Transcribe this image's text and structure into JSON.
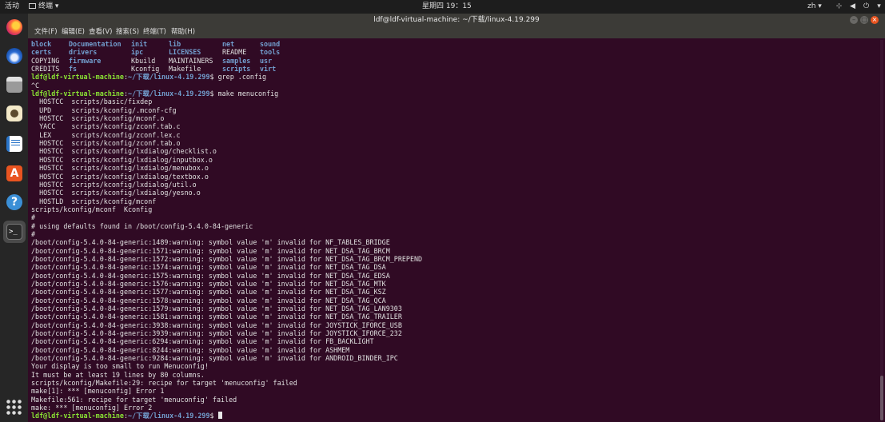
{
  "topbar": {
    "activities": "活动",
    "app_menu": "终端",
    "clock": "星期四 19：15",
    "lang": "zh",
    "icons": [
      "network-icon",
      "volume-icon",
      "power-icon",
      "chevron-down-icon"
    ]
  },
  "dock": {
    "items": [
      {
        "name": "firefox",
        "icon": "firefox-icon"
      },
      {
        "name": "thunderbird",
        "icon": "mail-icon"
      },
      {
        "name": "files",
        "icon": "folder-icon"
      },
      {
        "name": "rhythmbox",
        "icon": "music-icon"
      },
      {
        "name": "writer",
        "icon": "document-icon"
      },
      {
        "name": "software",
        "icon": "software-center-icon",
        "glyph": "A"
      },
      {
        "name": "help",
        "icon": "help-icon",
        "glyph": "?"
      },
      {
        "name": "terminal",
        "icon": "terminal-icon",
        "glyph": ">_",
        "active": true
      }
    ]
  },
  "window": {
    "title": "ldf@ldf-virtual-machine: ~/下载/linux-4.19.299",
    "menu": {
      "file": "文件(F)",
      "edit": "编辑(E)",
      "view": "查看(V)",
      "search": "搜索(S)",
      "terminal": "终端(T)",
      "help": "帮助(H)"
    }
  },
  "terminal": {
    "ls_columns": [
      [
        {
          "t": "block",
          "c": "b"
        },
        {
          "t": "certs",
          "c": "b"
        },
        {
          "t": "COPYING",
          "c": ""
        },
        {
          "t": "CREDITS",
          "c": ""
        }
      ],
      [
        {
          "t": "Documentation",
          "c": "b"
        },
        {
          "t": "drivers",
          "c": "b"
        },
        {
          "t": "firmware",
          "c": "b"
        },
        {
          "t": "fs",
          "c": "b"
        }
      ],
      [
        {
          "t": "init",
          "c": "b"
        },
        {
          "t": "ipc",
          "c": "b"
        },
        {
          "t": "Kbuild",
          "c": ""
        },
        {
          "t": "Kconfig",
          "c": ""
        }
      ],
      [
        {
          "t": "lib",
          "c": "b"
        },
        {
          "t": "LICENSES",
          "c": "b"
        },
        {
          "t": "MAINTAINERS",
          "c": ""
        },
        {
          "t": "Makefile",
          "c": ""
        }
      ],
      [
        {
          "t": "net",
          "c": "b"
        },
        {
          "t": "README",
          "c": ""
        },
        {
          "t": "samples",
          "c": "b"
        },
        {
          "t": "scripts",
          "c": "b"
        }
      ],
      [
        {
          "t": "sound",
          "c": "b"
        },
        {
          "t": "tools",
          "c": "b"
        },
        {
          "t": "usr",
          "c": "b"
        },
        {
          "t": "virt",
          "c": "b"
        }
      ]
    ],
    "prompt_user": "ldf@ldf-virtual-machine",
    "prompt_path": "~/下载/linux-4.19.299",
    "lines": [
      {
        "type": "prompt",
        "cmd": "grep .config"
      },
      {
        "type": "out",
        "text": "^C"
      },
      {
        "type": "prompt",
        "cmd": "make menuconfig"
      },
      {
        "type": "out",
        "text": "  HOSTCC  scripts/basic/fixdep"
      },
      {
        "type": "out",
        "text": "  UPD     scripts/kconfig/.mconf-cfg"
      },
      {
        "type": "out",
        "text": "  HOSTCC  scripts/kconfig/mconf.o"
      },
      {
        "type": "out",
        "text": "  YACC    scripts/kconfig/zconf.tab.c"
      },
      {
        "type": "out",
        "text": "  LEX     scripts/kconfig/zconf.lex.c"
      },
      {
        "type": "out",
        "text": "  HOSTCC  scripts/kconfig/zconf.tab.o"
      },
      {
        "type": "out",
        "text": "  HOSTCC  scripts/kconfig/lxdialog/checklist.o"
      },
      {
        "type": "out",
        "text": "  HOSTCC  scripts/kconfig/lxdialog/inputbox.o"
      },
      {
        "type": "out",
        "text": "  HOSTCC  scripts/kconfig/lxdialog/menubox.o"
      },
      {
        "type": "out",
        "text": "  HOSTCC  scripts/kconfig/lxdialog/textbox.o"
      },
      {
        "type": "out",
        "text": "  HOSTCC  scripts/kconfig/lxdialog/util.o"
      },
      {
        "type": "out",
        "text": "  HOSTCC  scripts/kconfig/lxdialog/yesno.o"
      },
      {
        "type": "out",
        "text": "  HOSTLD  scripts/kconfig/mconf"
      },
      {
        "type": "out",
        "text": "scripts/kconfig/mconf  Kconfig"
      },
      {
        "type": "out",
        "text": "#"
      },
      {
        "type": "out",
        "text": "# using defaults found in /boot/config-5.4.0-84-generic"
      },
      {
        "type": "out",
        "text": "#"
      },
      {
        "type": "out",
        "text": "/boot/config-5.4.0-84-generic:1489:warning: symbol value 'm' invalid for NF_TABLES_BRIDGE"
      },
      {
        "type": "out",
        "text": "/boot/config-5.4.0-84-generic:1571:warning: symbol value 'm' invalid for NET_DSA_TAG_BRCM"
      },
      {
        "type": "out",
        "text": "/boot/config-5.4.0-84-generic:1572:warning: symbol value 'm' invalid for NET_DSA_TAG_BRCM_PREPEND"
      },
      {
        "type": "out",
        "text": "/boot/config-5.4.0-84-generic:1574:warning: symbol value 'm' invalid for NET_DSA_TAG_DSA"
      },
      {
        "type": "out",
        "text": "/boot/config-5.4.0-84-generic:1575:warning: symbol value 'm' invalid for NET_DSA_TAG_EDSA"
      },
      {
        "type": "out",
        "text": "/boot/config-5.4.0-84-generic:1576:warning: symbol value 'm' invalid for NET_DSA_TAG_MTK"
      },
      {
        "type": "out",
        "text": "/boot/config-5.4.0-84-generic:1577:warning: symbol value 'm' invalid for NET_DSA_TAG_KSZ"
      },
      {
        "type": "out",
        "text": "/boot/config-5.4.0-84-generic:1578:warning: symbol value 'm' invalid for NET_DSA_TAG_QCA"
      },
      {
        "type": "out",
        "text": "/boot/config-5.4.0-84-generic:1579:warning: symbol value 'm' invalid for NET_DSA_TAG_LAN9303"
      },
      {
        "type": "out",
        "text": "/boot/config-5.4.0-84-generic:1581:warning: symbol value 'm' invalid for NET_DSA_TAG_TRAILER"
      },
      {
        "type": "out",
        "text": "/boot/config-5.4.0-84-generic:3938:warning: symbol value 'm' invalid for JOYSTICK_IFORCE_USB"
      },
      {
        "type": "out",
        "text": "/boot/config-5.4.0-84-generic:3939:warning: symbol value 'm' invalid for JOYSTICK_IFORCE_232"
      },
      {
        "type": "out",
        "text": "/boot/config-5.4.0-84-generic:6294:warning: symbol value 'm' invalid for FB_BACKLIGHT"
      },
      {
        "type": "out",
        "text": "/boot/config-5.4.0-84-generic:8244:warning: symbol value 'm' invalid for ASHMEM"
      },
      {
        "type": "out",
        "text": "/boot/config-5.4.0-84-generic:9284:warning: symbol value 'm' invalid for ANDROID_BINDER_IPC"
      },
      {
        "type": "out",
        "text": "Your display is too small to run Menuconfig!"
      },
      {
        "type": "out",
        "text": "It must be at least 19 lines by 80 columns."
      },
      {
        "type": "out",
        "text": "scripts/kconfig/Makefile:29: recipe for target 'menuconfig' failed"
      },
      {
        "type": "out",
        "text": "make[1]: *** [menuconfig] Error 1"
      },
      {
        "type": "out",
        "text": "Makefile:561: recipe for target 'menuconfig' failed"
      },
      {
        "type": "out",
        "text": "make: *** [menuconfig] Error 2"
      },
      {
        "type": "prompt",
        "cmd": "",
        "cursor": true
      }
    ]
  },
  "colors": {
    "terminal_bg": "#300a24",
    "prompt_user": "#8ae234",
    "prompt_path": "#729fcf",
    "close_button": "#e95420"
  }
}
